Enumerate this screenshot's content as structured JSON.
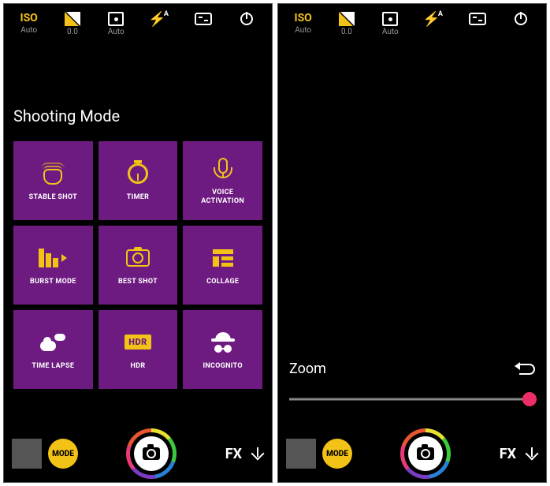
{
  "topbar": {
    "iso_label": "ISO",
    "iso_value": "Auto",
    "exposure_value": "0.0",
    "focus_value": "Auto",
    "flash_auto_suffix": "A"
  },
  "shooting_mode": {
    "title": "Shooting Mode",
    "tiles": [
      {
        "label": "STABLE SHOT"
      },
      {
        "label": "TIMER"
      },
      {
        "label": "VOICE\nACTIVATION"
      },
      {
        "label": "BURST MODE"
      },
      {
        "label": "BEST SHOT"
      },
      {
        "label": "COLLAGE"
      },
      {
        "label": "TIME LAPSE"
      },
      {
        "label": "HDR",
        "badge": "HDR"
      },
      {
        "label": "INCOGNITO"
      }
    ]
  },
  "zoom": {
    "label": "Zoom"
  },
  "bottombar": {
    "mode_label": "MODE",
    "fx_label": "FX"
  }
}
